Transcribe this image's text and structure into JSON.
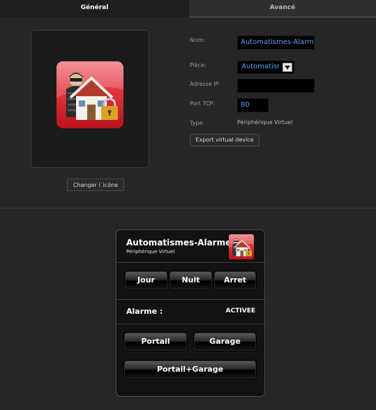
{
  "tabs": {
    "general": "Général",
    "advanced": "Avancé"
  },
  "icon_panel": {
    "change_icon_label": "Changer l´icône",
    "icon": "house-alarm-thief-icon"
  },
  "form": {
    "name_label": "Nom:",
    "name_value": "Automatismes-Alarme",
    "room_label": "Pièce:",
    "room_value": "Automatismes",
    "ip_label": "Adresse IP:",
    "ip_value": "",
    "port_label": "Port TCP:",
    "port_value": "80",
    "type_label": "Type:",
    "type_value": "Périphérique Virtuel",
    "export_label": "Export virtual device"
  },
  "widget": {
    "title": "Automatismes-Alarme",
    "subtitle": "Périphérique Virtuel",
    "mode_buttons": [
      "Jour",
      "Nuit",
      "Arret"
    ],
    "status_label": "Alarme :",
    "status_value": "ACTIVEE",
    "gate_buttons": [
      "Portail",
      "Garage"
    ],
    "combo_button": "Portail+Garage"
  },
  "colors": {
    "accent_text": "#5aa0ff",
    "icon_red": "#d9303a",
    "background": "#262626"
  }
}
